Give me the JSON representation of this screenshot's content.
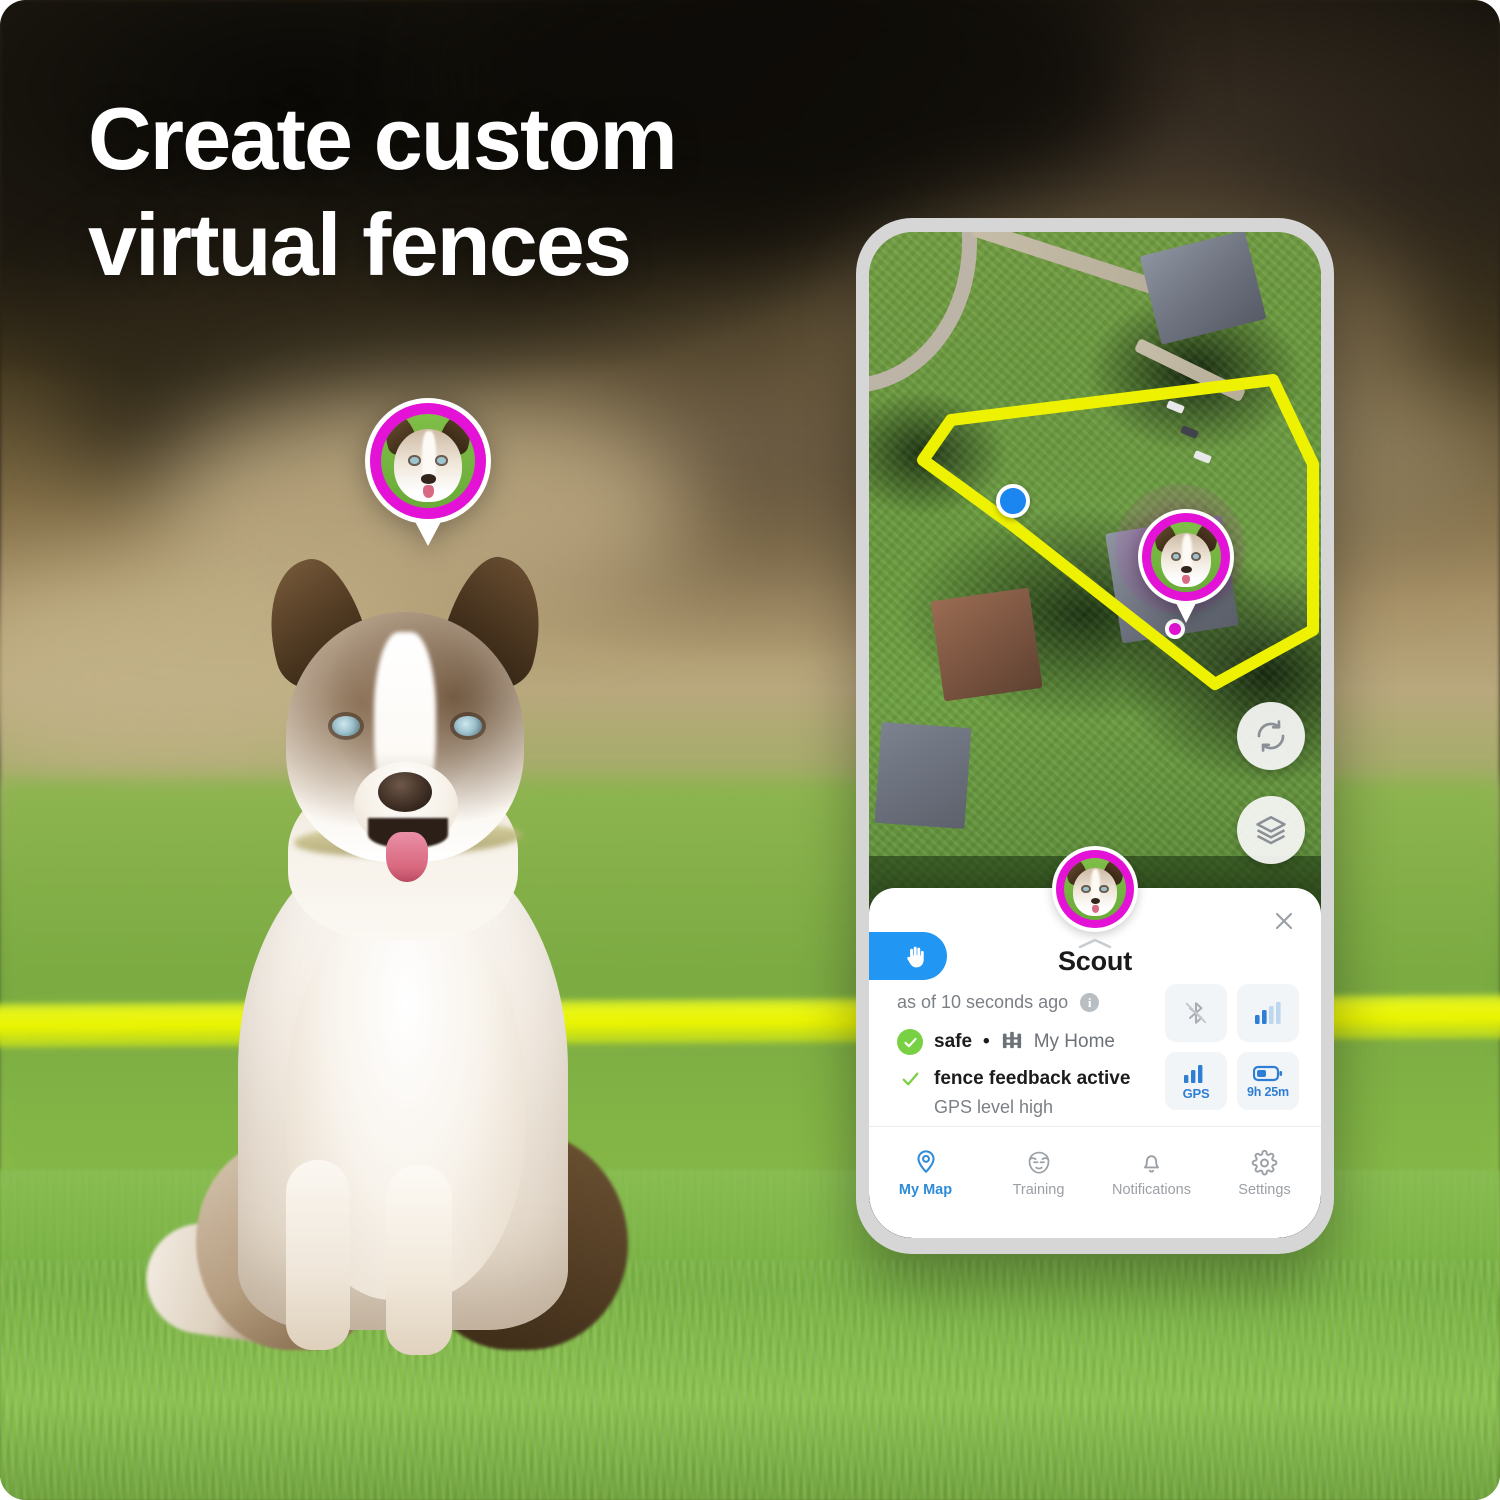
{
  "headline": {
    "line1": "Create custom",
    "line2": "virtual fences"
  },
  "colors": {
    "brand_magenta": "#e312d6",
    "fence_yellow": "#eaf400",
    "accent_blue": "#2e8bd8",
    "hand_button_blue": "#2196f3",
    "safe_green": "#78d043",
    "tile_bg": "#f2f5f8",
    "phone_bezel": "#d6d6d6"
  },
  "hero": {
    "pin_name": "pet-location-pin",
    "fence_band_name": "virtual-fence-line"
  },
  "phone": {
    "map": {
      "title": "satellite-map",
      "my_location_marker": "blue-location-dot",
      "pet_marker": "pet-map-pin",
      "pet_gps_dot": "magenta-gps-dot",
      "fence_polygon": "yellow-virtual-fence",
      "controls": [
        {
          "name": "refresh-button",
          "icon": "refresh-icon"
        },
        {
          "name": "layers-button",
          "icon": "layers-icon"
        }
      ]
    },
    "sheet": {
      "close_icon": "close-icon",
      "hand_button_icon": "hand-icon",
      "expand_chevron_icon": "chevron-up-icon",
      "pet_name": "Scout",
      "as_of": "as of 10 seconds ago",
      "info_icon_char": "i",
      "status_safe": "safe",
      "separator": "•",
      "fence_icon": "fence-icon",
      "place": "My Home",
      "fence_feedback": "fence feedback active",
      "gps_level": "GPS level high",
      "tiles": [
        {
          "name": "bluetooth-tile",
          "icon": "bluetooth-off-icon",
          "label": "",
          "state": "off"
        },
        {
          "name": "cellular-tile",
          "icon": "signal-bars-icon",
          "label": "",
          "state": "on"
        },
        {
          "name": "gps-tile",
          "icon": "signal-bars-icon",
          "label": "GPS",
          "state": "on"
        },
        {
          "name": "battery-tile",
          "icon": "battery-icon",
          "label": "9h 25m",
          "state": "on"
        }
      ]
    },
    "nav": [
      {
        "name": "nav-my-map",
        "label": "My Map",
        "icon": "map-pin-icon",
        "active": true
      },
      {
        "name": "nav-training",
        "label": "Training",
        "icon": "face-icon",
        "active": false
      },
      {
        "name": "nav-notifications",
        "label": "Notifications",
        "icon": "bell-icon",
        "active": false
      },
      {
        "name": "nav-settings",
        "label": "Settings",
        "icon": "gear-icon",
        "active": false
      }
    ]
  }
}
